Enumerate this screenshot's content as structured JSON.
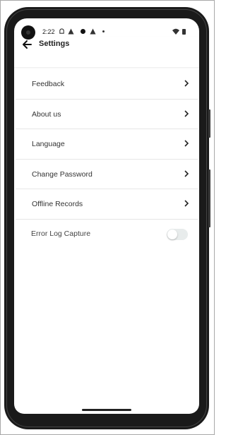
{
  "status_bar": {
    "time": "2:22",
    "icons": [
      "android-icon",
      "warning-icon",
      "circle-icon",
      "warning-icon",
      "dot-icon",
      "wifi-icon",
      "battery-icon"
    ]
  },
  "header": {
    "title": "Settings",
    "back_icon": "arrow-left-icon"
  },
  "settings": {
    "items": [
      {
        "label": "Feedback"
      },
      {
        "label": "About us"
      },
      {
        "label": "Language"
      },
      {
        "label": "Change Password"
      },
      {
        "label": "Offline Records"
      }
    ],
    "toggle": {
      "label": "Error Log Capture",
      "on": false
    }
  },
  "colors": {
    "text": "#333333",
    "divider": "#e6e6e6",
    "toggle_off": "#e8ecec"
  }
}
